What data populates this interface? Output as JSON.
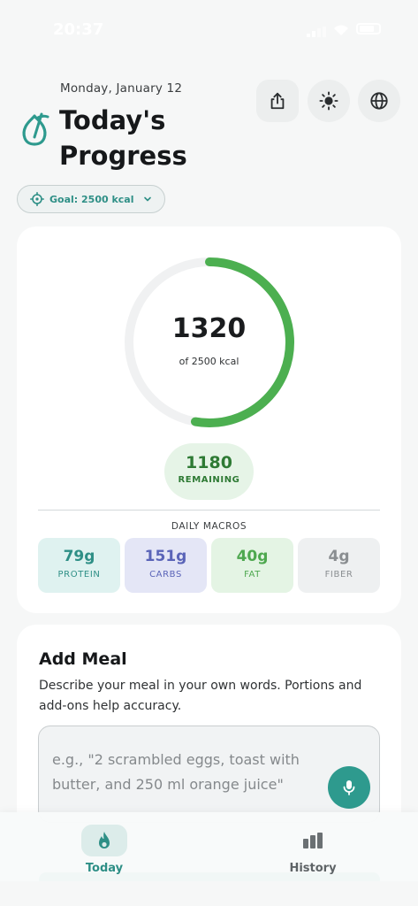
{
  "status_bar": {
    "time": "20:37"
  },
  "header": {
    "date": "Monday, January 12",
    "title": "Today's Progress",
    "icons": [
      "share-icon",
      "sun-icon",
      "globe-icon"
    ]
  },
  "goal": {
    "label": "Goal: 2500 kcal"
  },
  "progress": {
    "consumed": "1320",
    "goal_text": "of 2500 kcal",
    "fraction": 0.528,
    "remaining_value": "1180",
    "remaining_label": "REMAINING"
  },
  "macros": {
    "title": "DAILY MACROS",
    "items": [
      {
        "value": "79g",
        "label": "PROTEIN",
        "color": "#2e8f86",
        "bg": "#dff2f0"
      },
      {
        "value": "151g",
        "label": "CARBS",
        "color": "#5a64b8",
        "bg": "#e4e6f6"
      },
      {
        "value": "40g",
        "label": "FAT",
        "color": "#4ea84f",
        "bg": "#e4f4e4"
      },
      {
        "value": "4g",
        "label": "FIBER",
        "color": "#8a8e91",
        "bg": "#eef0f1"
      }
    ]
  },
  "add_meal": {
    "title": "Add Meal",
    "description": "Describe your meal in your own words. Portions and add-ons help accuracy.",
    "placeholder": "e.g., \"2 scrambled eggs, toast with butter, and 250 ml orange juice\""
  },
  "nav": {
    "today_label": "Today",
    "history_label": "History"
  },
  "colors": {
    "accent": "#2e9a8e",
    "ring_progress": "#4caf50",
    "ring_track": "#f0f1f2"
  }
}
